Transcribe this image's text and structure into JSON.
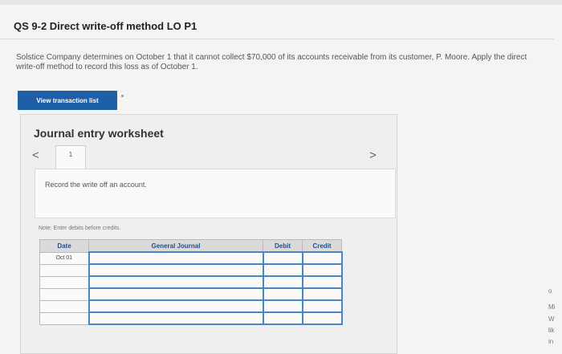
{
  "header": {
    "title": "QS 9-2 Direct write-off method LO P1"
  },
  "problem": {
    "text": "Solstice Company determines on October 1 that it cannot collect $70,000 of its accounts receivable from its customer, P. Moore. Apply the direct write-off method to record this loss as of October 1."
  },
  "toolbar": {
    "view_transactions_label": "View transaction list"
  },
  "worksheet": {
    "title": "Journal entry worksheet",
    "prev_symbol": "<",
    "next_symbol": ">",
    "tab_label": "1",
    "instruction": "Record the write off an account.",
    "note": "Note: Enter debits before credits."
  },
  "journal": {
    "columns": [
      "Date",
      "General Journal",
      "Debit",
      "Credit"
    ],
    "rows": [
      {
        "date": "Oct 01",
        "account": "",
        "debit": "",
        "credit": ""
      },
      {
        "date": "",
        "account": "",
        "debit": "",
        "credit": ""
      },
      {
        "date": "",
        "account": "",
        "debit": "",
        "credit": ""
      },
      {
        "date": "",
        "account": "",
        "debit": "",
        "credit": ""
      },
      {
        "date": "",
        "account": "",
        "debit": "",
        "credit": ""
      },
      {
        "date": "",
        "account": "",
        "debit": "",
        "credit": ""
      }
    ]
  },
  "side_fragments": [
    "o",
    "Mi",
    "W",
    "lik",
    "in"
  ]
}
